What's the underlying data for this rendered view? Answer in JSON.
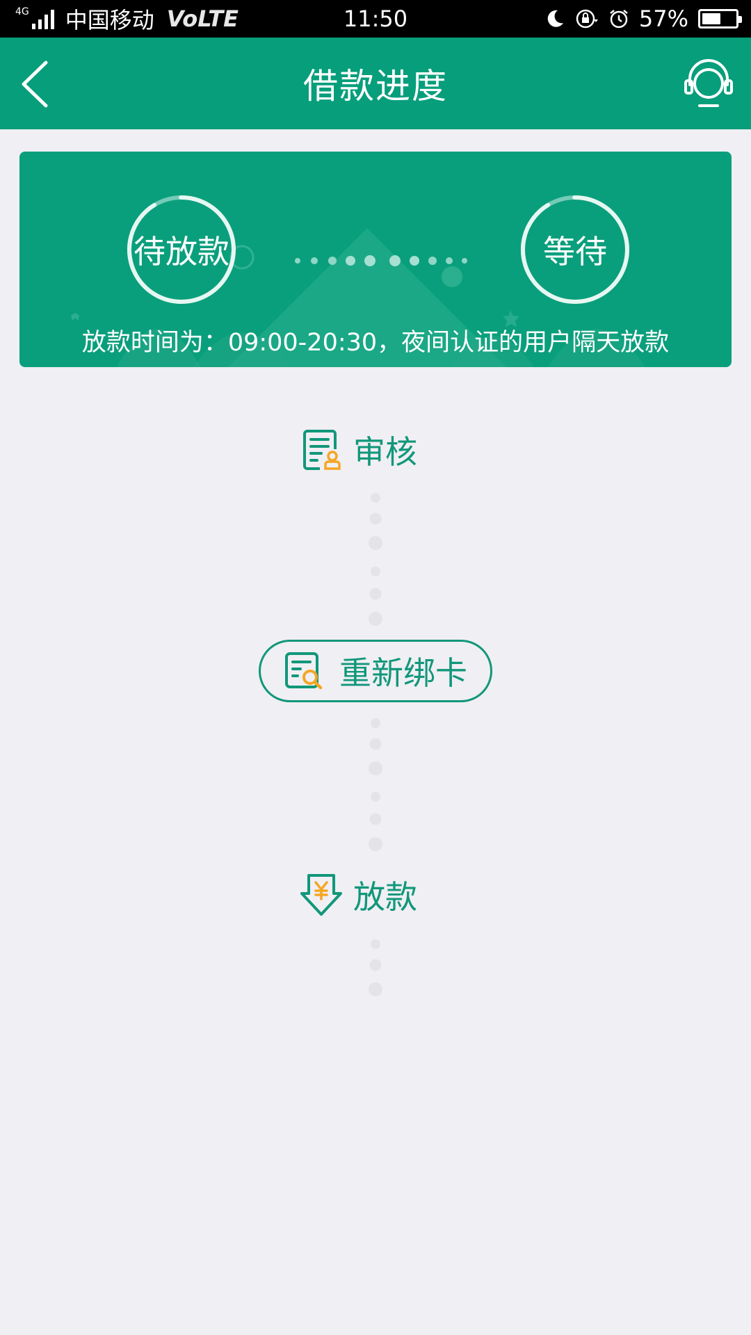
{
  "status_bar": {
    "network": "4G",
    "carrier": "中国移动",
    "volte": "VoLTE",
    "time": "11:50",
    "battery": "57%",
    "battery_level": 0.57
  },
  "header": {
    "title": "借款进度",
    "back_icon": "chevron-left-icon",
    "service_icon": "headset-icon"
  },
  "banner": {
    "status_current": "待放款",
    "status_next": "等待",
    "note": "放款时间为：09:00-20:30，夜间认证的用户隔天放款"
  },
  "steps": {
    "audit": "审核",
    "rebind_card": "重新绑卡",
    "release": "放款"
  },
  "colors": {
    "brand": "#079e7b",
    "accent_orange": "#f5a623",
    "page_bg": "#f0eff4"
  }
}
